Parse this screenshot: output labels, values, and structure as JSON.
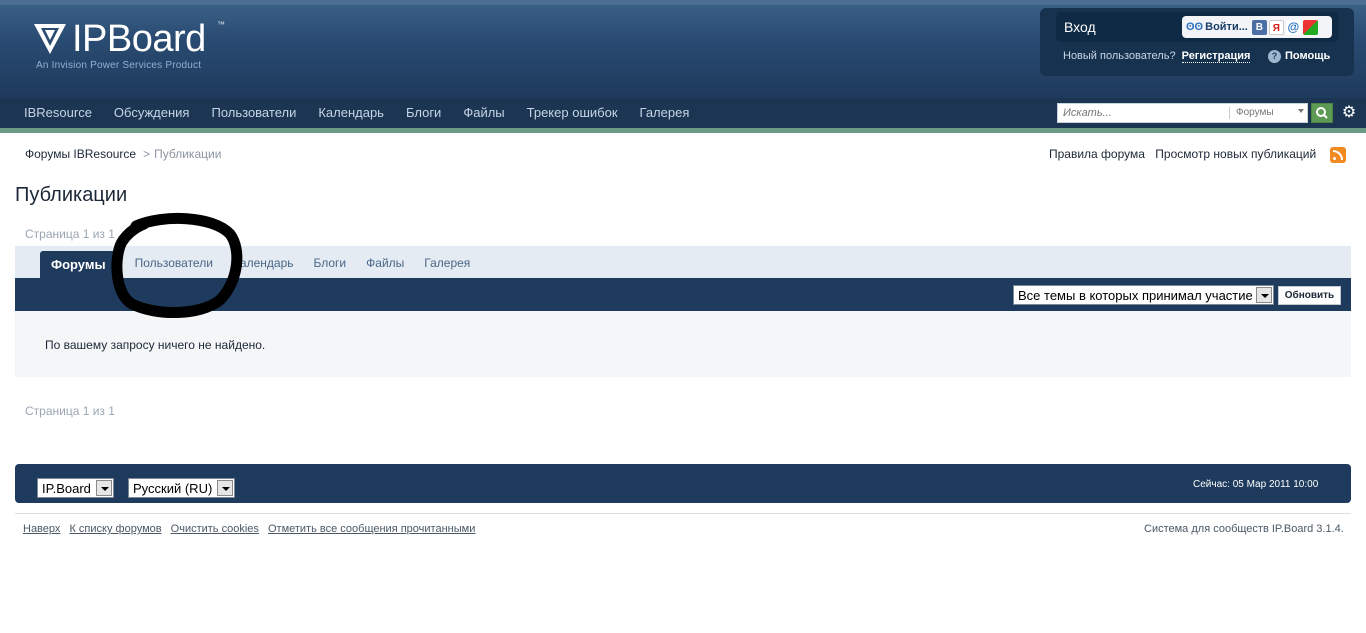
{
  "header": {
    "logo_name": "IPBoard",
    "logo_tm": "™",
    "logo_tagline": "An Invision Power Services Product"
  },
  "user_box": {
    "login_label": "Вход",
    "social_enter": "Войти...",
    "social_eyes": "ʘʘ",
    "social_vk": "В",
    "social_ya": "Я",
    "social_mail": "@",
    "new_user_text": "Новый пользователь?",
    "register_link": "Регистрация",
    "help_link": "Помощь"
  },
  "nav": {
    "items": [
      "IBResource",
      "Обсуждения",
      "Пользователи",
      "Календарь",
      "Блоги",
      "Файлы",
      "Трекер ошибок",
      "Галерея"
    ]
  },
  "search": {
    "placeholder": "Искать...",
    "scope": "Форумы"
  },
  "breadcrumb": {
    "home": "Форумы IBResource",
    "separator": ">",
    "current": "Публикации"
  },
  "top_links": {
    "rules": "Правила форума",
    "new_posts": "Просмотр новых публикаций"
  },
  "page": {
    "title": "Публикации",
    "pagination": "Страница 1 из 1"
  },
  "tabs": {
    "items": [
      {
        "label": "Форумы",
        "active": true
      },
      {
        "label": "Пользователи",
        "active": false
      },
      {
        "label": "Календарь",
        "active": false
      },
      {
        "label": "Блоги",
        "active": false
      },
      {
        "label": "Файлы",
        "active": false
      },
      {
        "label": "Галерея",
        "active": false
      }
    ]
  },
  "filter": {
    "selected": "Все темы в которых принимал участие",
    "refresh_label": "Обновить"
  },
  "results": {
    "empty_message": "По вашему запросу ничего не найдено."
  },
  "footer": {
    "skin": "IP.Board",
    "language": "Русский (RU)",
    "clock": "Сейчас: 05 Мар 2011 10:00",
    "links": [
      "Наверх",
      "К списку форумов",
      "Очистить cookies",
      "Отметить все сообщения прочитанными"
    ],
    "copyright": "Система для сообществ IP.Board 3.1.4."
  },
  "colors": {
    "header": "#2a4b72",
    "nav": "#1b3552",
    "accent_green": "#5d9b54",
    "tab_active": "#1e3a5c"
  }
}
